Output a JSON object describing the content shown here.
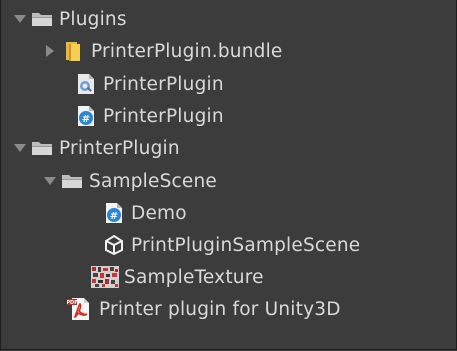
{
  "tree": {
    "items": [
      {
        "label": "Plugins",
        "icon": "folder-icon",
        "depth": 0,
        "arrow": "expanded"
      },
      {
        "label": "PrinterPlugin.bundle",
        "icon": "bundle-folder-icon",
        "depth": 1,
        "arrow": "collapsed"
      },
      {
        "label": "PrinterPlugin",
        "icon": "native-plugin-icon",
        "depth": 1,
        "arrow": "none"
      },
      {
        "label": "PrinterPlugin",
        "icon": "csharp-script-icon",
        "depth": 1,
        "arrow": "none"
      },
      {
        "label": "PrinterPlugin",
        "icon": "folder-icon",
        "depth": 0,
        "arrow": "expanded"
      },
      {
        "label": "SampleScene",
        "icon": "folder-icon",
        "depth": 1,
        "arrow": "expanded"
      },
      {
        "label": "Demo",
        "icon": "csharp-script-icon",
        "depth": 2,
        "arrow": "none"
      },
      {
        "label": "PrintPluginSampleScene",
        "icon": "unity-scene-icon",
        "depth": 2,
        "arrow": "none"
      },
      {
        "label": "SampleTexture",
        "icon": "texture-icon",
        "depth": 2,
        "arrow": "none"
      },
      {
        "label": "Printer plugin for Unity3D",
        "icon": "pdf-icon",
        "depth": 1,
        "arrow": "none"
      }
    ]
  }
}
